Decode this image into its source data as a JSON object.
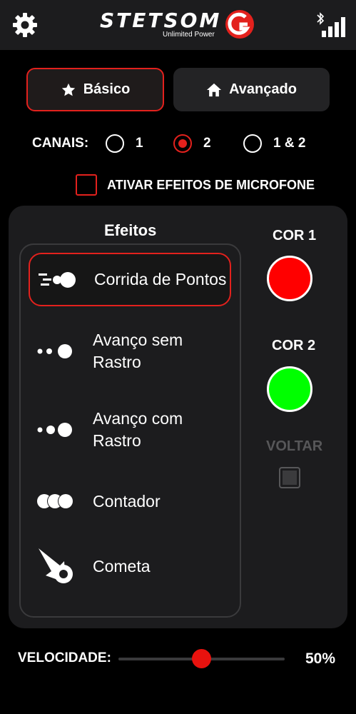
{
  "header": {
    "logo_text": "STETSOM",
    "logo_subtitle": "Unlimited Power",
    "icons": [
      "gear-icon",
      "bluetooth-icon",
      "signal-icon"
    ]
  },
  "tabs": [
    {
      "label": "Básico",
      "icon": "star-icon",
      "selected": true
    },
    {
      "label": "Avançado",
      "icon": "home-icon",
      "selected": false
    }
  ],
  "canais": {
    "label": "CANAIS:",
    "options": [
      "1",
      "2",
      "1 & 2"
    ],
    "selected": "2"
  },
  "mic": {
    "label": "ATIVAR EFEITOS DE MICROFONE",
    "checked": false
  },
  "efeitos": {
    "title": "Efeitos",
    "items": [
      {
        "label": "Corrida de Pontos",
        "icon": "running-dots-icon",
        "selected": true
      },
      {
        "label": "Avanço sem Rastro",
        "icon": "advance-no-trail-icon",
        "selected": false
      },
      {
        "label": "Avanço com Rastro",
        "icon": "advance-with-trail-icon",
        "selected": false
      },
      {
        "label": "Contador",
        "icon": "counter-icon",
        "selected": false
      },
      {
        "label": "Cometa",
        "icon": "comet-icon",
        "selected": false
      }
    ]
  },
  "colors": {
    "cor1": {
      "label": "COR 1",
      "value": "#ff0000"
    },
    "cor2": {
      "label": "COR 2",
      "value": "#00ff00"
    },
    "accent": "#e3211d"
  },
  "voltar": {
    "label": "VOLTAR",
    "checked": false
  },
  "velocidade": {
    "label": "VELOCIDADE:",
    "value": 50,
    "display": "50%"
  }
}
